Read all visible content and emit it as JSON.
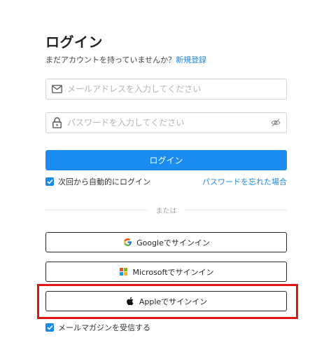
{
  "login": {
    "title": "ログイン",
    "signup_prompt": "まだアカウントを持っていませんか？",
    "signup_link": "新規登録",
    "email_placeholder": "メールアドレスを入力してください",
    "password_placeholder": "パスワードを入力してください",
    "submit_label": "ログイン",
    "remember_label": "次回から自動的にログイン",
    "remember_checked": true,
    "forgot_link": "パスワードを忘れた場合",
    "divider_text": "または"
  },
  "sso": {
    "google_label": "Googleでサインイン",
    "microsoft_label": "Microsoftでサインイン",
    "apple_label": "Appleでサインイン"
  },
  "newsletter": {
    "label": "メールマガジンを受信する",
    "checked": true
  },
  "colors": {
    "accent": "#1a8cf0",
    "link": "#1e88e5",
    "highlight": "#e01515"
  },
  "icons": {
    "email": "envelope-icon",
    "password": "lock-icon",
    "toggle_visibility": "eye-slash-icon",
    "google": "google-logo-icon",
    "microsoft": "microsoft-logo-icon",
    "apple": "apple-logo-icon",
    "checkbox": "checkmark-icon"
  }
}
